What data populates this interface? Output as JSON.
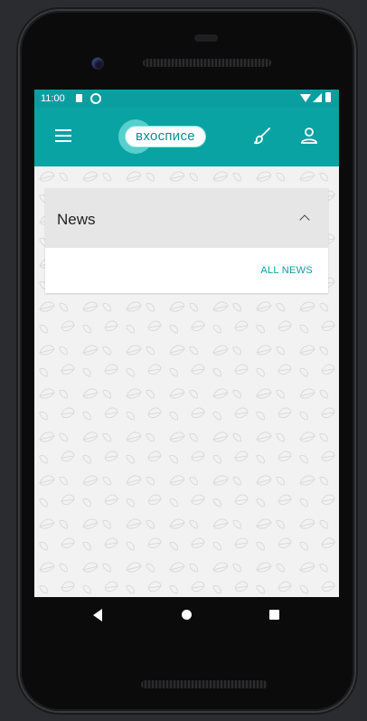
{
  "status_bar": {
    "time": "11:00"
  },
  "app_bar": {
    "logo_text": "вхосписе"
  },
  "news_card": {
    "title": "News",
    "all_news_label": "ALL NEWS"
  },
  "colors": {
    "accent": "#0aa3a3",
    "link": "#0a9ea0",
    "header_bg": "#e6e6e6"
  }
}
